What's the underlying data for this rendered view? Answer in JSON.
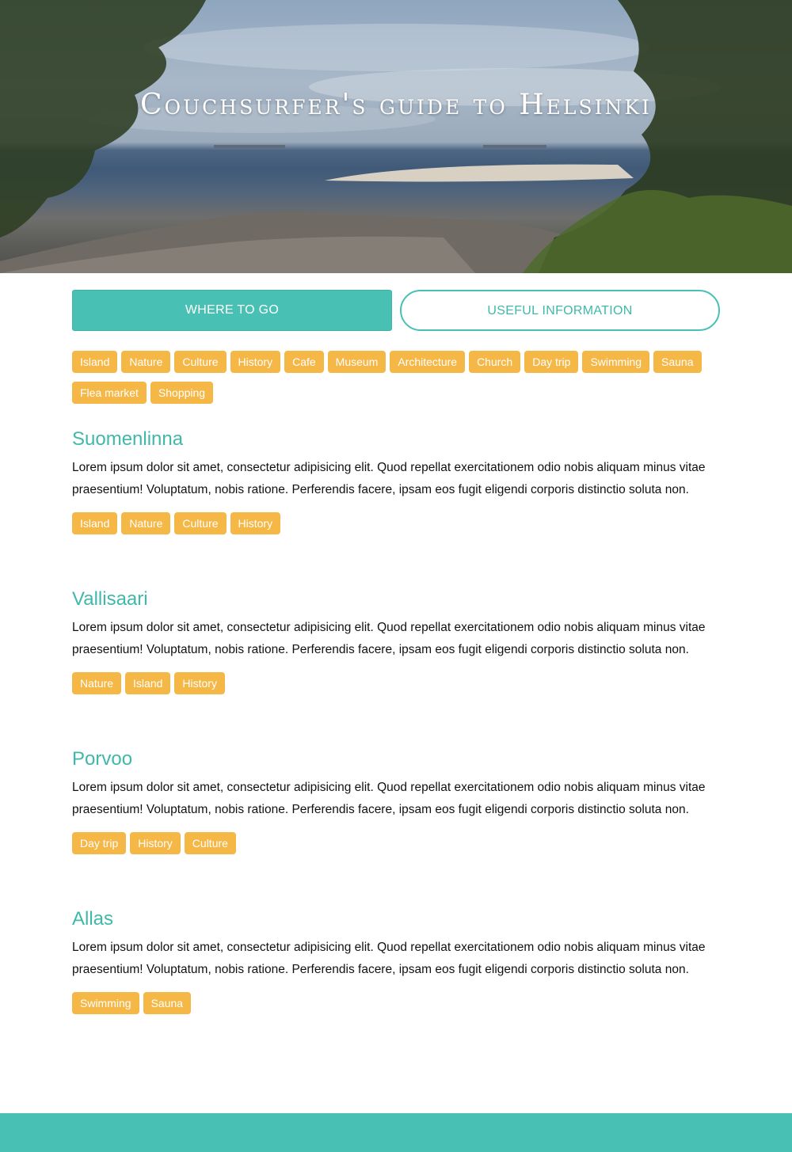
{
  "hero": {
    "title": "Couchsurfer's guide to Helsinki"
  },
  "tabs": [
    {
      "label": "WHERE TO GO"
    },
    {
      "label": "USEFUL INFORMATION"
    }
  ],
  "filters": [
    "Island",
    "Nature",
    "Culture",
    "History",
    "Cafe",
    "Museum",
    "Architecture",
    "Church",
    "Day trip",
    "Swimming",
    "Sauna",
    "Flea market",
    "Shopping"
  ],
  "places": [
    {
      "title": "Suomenlinna",
      "description": "Lorem ipsum dolor sit amet, consectetur adipisicing elit. Quod repellat exercitationem odio nobis aliquam minus vitae praesentium! Voluptatum, nobis ratione. Perferendis facere, ipsam eos fugit eligendi corporis distinctio soluta non.",
      "tags": [
        "Island",
        "Nature",
        "Culture",
        "History"
      ]
    },
    {
      "title": "Vallisaari",
      "description": "Lorem ipsum dolor sit amet, consectetur adipisicing elit. Quod repellat exercitationem odio nobis aliquam minus vitae praesentium! Voluptatum, nobis ratione. Perferendis facere, ipsam eos fugit eligendi corporis distinctio soluta non.",
      "tags": [
        "Nature",
        "Island",
        "History"
      ]
    },
    {
      "title": "Porvoo",
      "description": "Lorem ipsum dolor sit amet, consectetur adipisicing elit. Quod repellat exercitationem odio nobis aliquam minus vitae praesentium! Voluptatum, nobis ratione. Perferendis facere, ipsam eos fugit eligendi corporis distinctio soluta non.",
      "tags": [
        "Day trip",
        "History",
        "Culture"
      ]
    },
    {
      "title": "Allas",
      "description": "Lorem ipsum dolor sit amet, consectetur adipisicing elit. Quod repellat exercitationem odio nobis aliquam minus vitae praesentium! Voluptatum, nobis ratione. Perferendis facere, ipsam eos fugit eligendi corporis distinctio soluta non.",
      "tags": [
        "Swimming",
        "Sauna"
      ]
    }
  ],
  "colors": {
    "accent": "#48c0b3",
    "tag": "#f5b746"
  }
}
